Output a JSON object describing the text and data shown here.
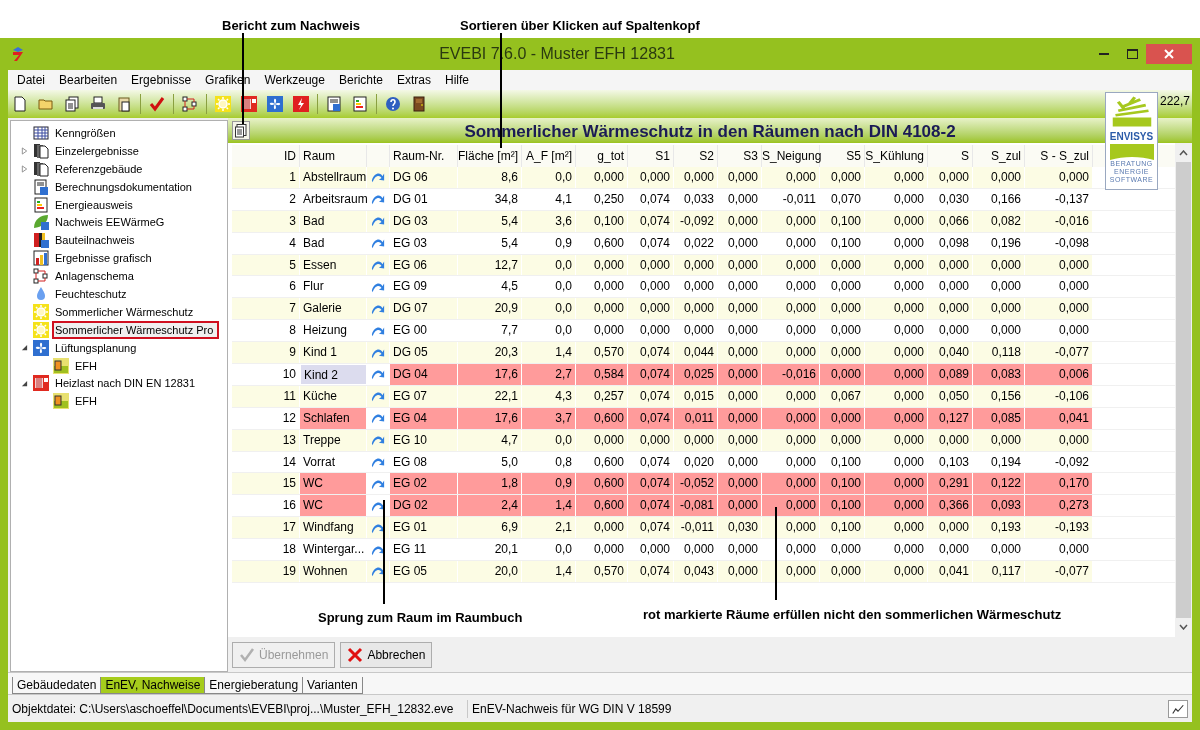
{
  "callouts": [
    {
      "text": "Bericht zum Nachweis"
    },
    {
      "text": "Sortieren über Klicken auf Spaltenkopf"
    },
    {
      "text": "Sprung zum Raum im Raumbuch"
    },
    {
      "text": "rot markierte Räume erfüllen nicht den sommerlichen Wärmeschutz"
    }
  ],
  "window": {
    "title": "EVEBI 7.6.0 - Muster EFH 12831"
  },
  "menu": [
    "Datei",
    "Bearbeiten",
    "Ergebnisse",
    "Grafiken",
    "Werkzeuge",
    "Berichte",
    "Extras",
    "Hilfe"
  ],
  "corner_value": "222,7",
  "logo": {
    "name": "ENVISYS",
    "tagline": [
      "BERATUNG",
      "ENERGIE",
      "SOFTWARE"
    ]
  },
  "tree": [
    {
      "label": "Kenngrößen",
      "selected": false
    },
    {
      "label": "Einzelergebnisse",
      "selected": false,
      "expanded": false
    },
    {
      "label": "Referenzgebäude",
      "selected": false,
      "expanded": false
    },
    {
      "label": "Berechnungsdokumentation",
      "selected": false
    },
    {
      "label": "Energieausweis",
      "selected": false
    },
    {
      "label": "Nachweis EEWärmeG",
      "selected": false
    },
    {
      "label": "Bauteilnachweis",
      "selected": false
    },
    {
      "label": "Ergebnisse grafisch",
      "selected": false
    },
    {
      "label": "Anlagenschema",
      "selected": false
    },
    {
      "label": "Feuchteschutz",
      "selected": false
    },
    {
      "label": "Sommerlicher Wärmeschutz",
      "selected": false
    },
    {
      "label": "Sommerlicher Wärmeschutz Pro",
      "selected": true
    },
    {
      "label": "Lüftungsplanung",
      "selected": false,
      "expanded": true,
      "children": [
        {
          "label": "EFH",
          "selected": false
        }
      ]
    },
    {
      "label": "Heizlast nach DIN EN 12831",
      "selected": false,
      "expanded": true,
      "children": [
        {
          "label": "EFH",
          "selected": false
        }
      ]
    }
  ],
  "panel_title": "Sommerlicher Wärmeschutz in den Räumen nach DIN 4108-2",
  "table": {
    "columns": [
      "ID",
      "Raum",
      "Raum-Nr.",
      "Fläche [m²]",
      "A_F [m²]",
      "g_tot",
      "S1",
      "S2",
      "S3",
      "S_Neigung",
      "S5",
      "S_Kühlung",
      "S",
      "S_zul",
      "S - S_zul"
    ],
    "rows": [
      {
        "cells": [
          "1",
          "Abstellraum",
          "DG 06",
          "8,6",
          "0,0",
          "0,000",
          "0,000",
          "0,000",
          "0,000",
          "0,000",
          "0,000",
          "0,000",
          "0,000",
          "0,000",
          "0,000"
        ],
        "fails": false,
        "selected": false
      },
      {
        "cells": [
          "2",
          "Arbeitsraum",
          "DG 01",
          "34,8",
          "4,1",
          "0,250",
          "0,074",
          "0,033",
          "0,000",
          "-0,011",
          "0,070",
          "0,000",
          "0,030",
          "0,166",
          "-0,137"
        ],
        "fails": false,
        "selected": false
      },
      {
        "cells": [
          "3",
          "Bad",
          "DG 03",
          "5,4",
          "3,6",
          "0,100",
          "0,074",
          "-0,092",
          "0,000",
          "0,000",
          "0,100",
          "0,000",
          "0,066",
          "0,082",
          "-0,016"
        ],
        "fails": false,
        "selected": false
      },
      {
        "cells": [
          "4",
          "Bad",
          "EG 03",
          "5,4",
          "0,9",
          "0,600",
          "0,074",
          "0,022",
          "0,000",
          "0,000",
          "0,100",
          "0,000",
          "0,098",
          "0,196",
          "-0,098"
        ],
        "fails": false,
        "selected": false
      },
      {
        "cells": [
          "5",
          "Essen",
          "EG 06",
          "12,7",
          "0,0",
          "0,000",
          "0,000",
          "0,000",
          "0,000",
          "0,000",
          "0,000",
          "0,000",
          "0,000",
          "0,000",
          "0,000"
        ],
        "fails": false,
        "selected": false
      },
      {
        "cells": [
          "6",
          "Flur",
          "EG 09",
          "4,5",
          "0,0",
          "0,000",
          "0,000",
          "0,000",
          "0,000",
          "0,000",
          "0,000",
          "0,000",
          "0,000",
          "0,000",
          "0,000"
        ],
        "fails": false,
        "selected": false
      },
      {
        "cells": [
          "7",
          "Galerie",
          "DG 07",
          "20,9",
          "0,0",
          "0,000",
          "0,000",
          "0,000",
          "0,000",
          "0,000",
          "0,000",
          "0,000",
          "0,000",
          "0,000",
          "0,000"
        ],
        "fails": false,
        "selected": false
      },
      {
        "cells": [
          "8",
          "Heizung",
          "EG 00",
          "7,7",
          "0,0",
          "0,000",
          "0,000",
          "0,000",
          "0,000",
          "0,000",
          "0,000",
          "0,000",
          "0,000",
          "0,000",
          "0,000"
        ],
        "fails": false,
        "selected": false
      },
      {
        "cells": [
          "9",
          "Kind 1",
          "DG 05",
          "20,3",
          "1,4",
          "0,570",
          "0,074",
          "0,044",
          "0,000",
          "0,000",
          "0,000",
          "0,000",
          "0,040",
          "0,118",
          "-0,077"
        ],
        "fails": false,
        "selected": false
      },
      {
        "cells": [
          "10",
          "Kind 2",
          "DG 04",
          "17,6",
          "2,7",
          "0,584",
          "0,074",
          "0,025",
          "0,000",
          "-0,016",
          "0,000",
          "0,000",
          "0,089",
          "0,083",
          "0,006"
        ],
        "fails": true,
        "selected": true
      },
      {
        "cells": [
          "11",
          "Küche",
          "EG 07",
          "22,1",
          "4,3",
          "0,257",
          "0,074",
          "0,015",
          "0,000",
          "0,000",
          "0,067",
          "0,000",
          "0,050",
          "0,156",
          "-0,106"
        ],
        "fails": false,
        "selected": false
      },
      {
        "cells": [
          "12",
          "Schlafen",
          "EG 04",
          "17,6",
          "3,7",
          "0,600",
          "0,074",
          "0,011",
          "0,000",
          "0,000",
          "0,000",
          "0,000",
          "0,127",
          "0,085",
          "0,041"
        ],
        "fails": true,
        "selected": false
      },
      {
        "cells": [
          "13",
          "Treppe",
          "EG 10",
          "4,7",
          "0,0",
          "0,000",
          "0,000",
          "0,000",
          "0,000",
          "0,000",
          "0,000",
          "0,000",
          "0,000",
          "0,000",
          "0,000"
        ],
        "fails": false,
        "selected": false
      },
      {
        "cells": [
          "14",
          "Vorrat",
          "EG 08",
          "5,0",
          "0,8",
          "0,600",
          "0,074",
          "0,020",
          "0,000",
          "0,000",
          "0,100",
          "0,000",
          "0,103",
          "0,194",
          "-0,092"
        ],
        "fails": false,
        "selected": false
      },
      {
        "cells": [
          "15",
          "WC",
          "EG 02",
          "1,8",
          "0,9",
          "0,600",
          "0,074",
          "-0,052",
          "0,000",
          "0,000",
          "0,100",
          "0,000",
          "0,291",
          "0,122",
          "0,170"
        ],
        "fails": true,
        "selected": false
      },
      {
        "cells": [
          "16",
          "WC",
          "DG 02",
          "2,4",
          "1,4",
          "0,600",
          "0,074",
          "-0,081",
          "0,000",
          "0,000",
          "0,100",
          "0,000",
          "0,366",
          "0,093",
          "0,273"
        ],
        "fails": true,
        "selected": false
      },
      {
        "cells": [
          "17",
          "Windfang",
          "EG 01",
          "6,9",
          "2,1",
          "0,000",
          "0,074",
          "-0,011",
          "0,030",
          "0,000",
          "0,100",
          "0,000",
          "0,000",
          "0,193",
          "-0,193"
        ],
        "fails": false,
        "selected": false
      },
      {
        "cells": [
          "18",
          "Wintergar...",
          "EG 11",
          "20,1",
          "0,0",
          "0,000",
          "0,000",
          "0,000",
          "0,000",
          "0,000",
          "0,000",
          "0,000",
          "0,000",
          "0,000",
          "0,000"
        ],
        "fails": false,
        "selected": false
      },
      {
        "cells": [
          "19",
          "Wohnen",
          "EG 05",
          "20,0",
          "1,4",
          "0,570",
          "0,074",
          "0,043",
          "0,000",
          "0,000",
          "0,000",
          "0,000",
          "0,041",
          "0,117",
          "-0,077"
        ],
        "fails": false,
        "selected": false
      }
    ]
  },
  "buttons": [
    {
      "label": "Übernehmen",
      "disabled": true
    },
    {
      "label": "Abbrechen",
      "disabled": false
    }
  ],
  "tabs": [
    {
      "label": "Gebäudedaten",
      "selected": false
    },
    {
      "label": "EnEV, Nachweise",
      "selected": true
    },
    {
      "label": "Energieberatung",
      "selected": false
    },
    {
      "label": "Varianten",
      "selected": false
    }
  ],
  "status_bar": [
    "Objektdatei: C:\\Users\\aschoeffel\\Documents\\EVEBI\\proj...\\Muster_EFH_12832.eve",
    "EnEV-Nachweis für WG DIN V 18599"
  ]
}
